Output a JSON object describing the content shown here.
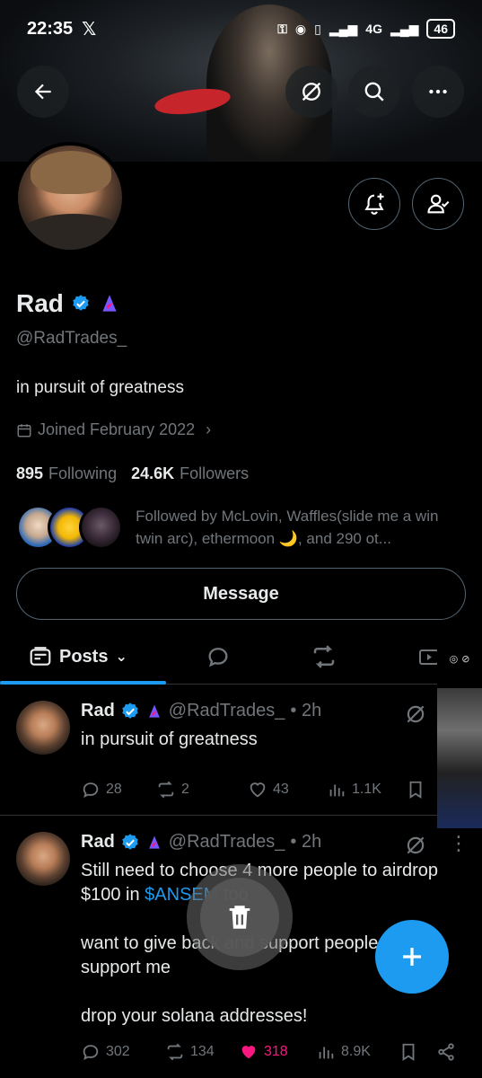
{
  "status_bar": {
    "time": "22:35",
    "network": "4G",
    "battery": "46"
  },
  "profile": {
    "name": "Rad",
    "handle": "@RadTrades_",
    "bio": "in pursuit of greatness",
    "joined": "Joined February 2022",
    "following_count": "895",
    "following_label": "Following",
    "followers_count": "24.6K",
    "followers_label": "Followers",
    "followed_by": "Followed by McLovin, Waffles(slide me a win twin arc), ethermoon 🌙, and 290 ot...",
    "message_label": "Message"
  },
  "tabs": [
    {
      "label": "Posts",
      "active": true
    },
    {
      "label": "",
      "active": false
    }
  ],
  "posts": [
    {
      "name": "Rad",
      "handle": "@RadTrades_",
      "time": "• 2h",
      "text": "in pursuit of greatness",
      "replies": "28",
      "reposts": "2",
      "likes": "43",
      "views": "1.1K"
    },
    {
      "name": "Rad",
      "handle": "@RadTrades_",
      "time": "• 2h",
      "text_before": "Still need to choose 4 more people to airdrop $100 in ",
      "text_link": "$ANSEM",
      "text_after": " too\n\nwant to give back and support people who support me\n\ndrop your solana addresses!",
      "replies": "302",
      "reposts": "134",
      "likes": "318",
      "views": "8.9K"
    }
  ],
  "colors": {
    "accent": "#1d9bf0",
    "like": "#f91880",
    "secondary_text": "#71767b",
    "border": "#2f3336"
  }
}
